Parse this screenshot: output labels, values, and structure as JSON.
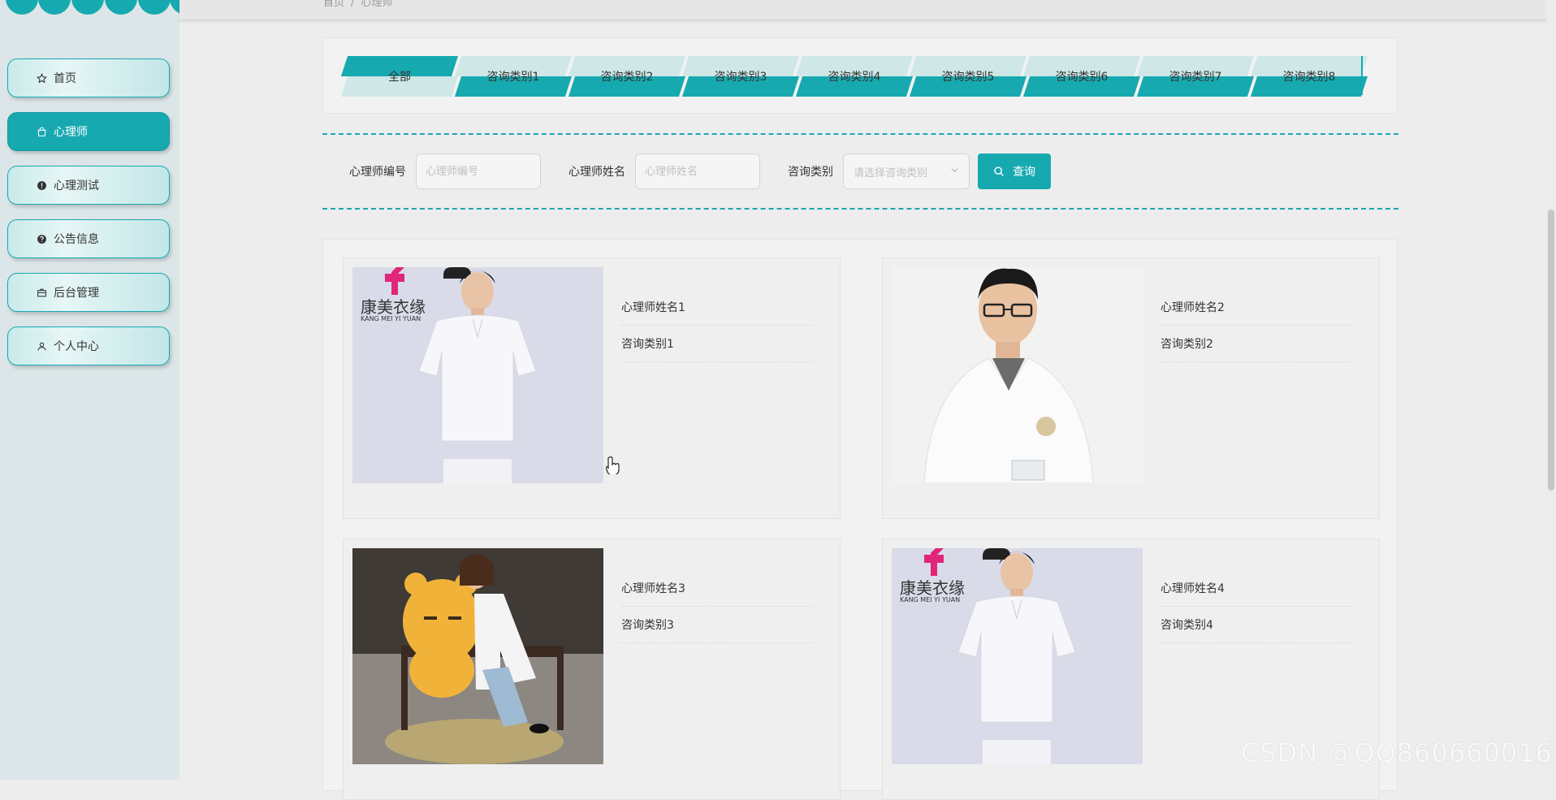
{
  "breadcrumb": {
    "home": "首页",
    "separator": "/",
    "current": "心理师"
  },
  "sidebar": {
    "items": [
      {
        "label": "首页",
        "icon": "star-icon",
        "active": false
      },
      {
        "label": "心理师",
        "icon": "bag-icon",
        "active": true
      },
      {
        "label": "心理测试",
        "icon": "alert-circle-icon",
        "active": false
      },
      {
        "label": "公告信息",
        "icon": "question-circle-icon",
        "active": false
      },
      {
        "label": "后台管理",
        "icon": "briefcase-icon",
        "active": false
      },
      {
        "label": "个人中心",
        "icon": "user-icon",
        "active": false
      }
    ]
  },
  "tabs": [
    {
      "label": "全部",
      "active": true
    },
    {
      "label": "咨询类别1",
      "active": false
    },
    {
      "label": "咨询类别2",
      "active": false
    },
    {
      "label": "咨询类别3",
      "active": false
    },
    {
      "label": "咨询类别4",
      "active": false
    },
    {
      "label": "咨询类别5",
      "active": false
    },
    {
      "label": "咨询类别6",
      "active": false
    },
    {
      "label": "咨询类别7",
      "active": false
    },
    {
      "label": "咨询类别8",
      "active": false
    }
  ],
  "search": {
    "id_label": "心理师编号",
    "id_placeholder": "心理师编号",
    "name_label": "心理师姓名",
    "name_placeholder": "心理师姓名",
    "category_label": "咨询类别",
    "category_placeholder": "请选择咨询类别",
    "query_button": "查询"
  },
  "cards": [
    {
      "name": "心理师姓名1",
      "category": "咨询类别1"
    },
    {
      "name": "心理师姓名2",
      "category": "咨询类别2"
    },
    {
      "name": "心理师姓名3",
      "category": "咨询类别3"
    },
    {
      "name": "心理师姓名4",
      "category": "咨询类别4"
    }
  ],
  "photo_logo": {
    "cn": "康美衣缘",
    "en": "KANG MEI YI YUAN"
  },
  "watermark": "CSDN @QQ860660016",
  "colors": {
    "accent": "#17a9b0",
    "tab_light": "#cfe7e7",
    "sidebar_bg": "#dce6e8",
    "logo_magenta": "#e0257a"
  }
}
